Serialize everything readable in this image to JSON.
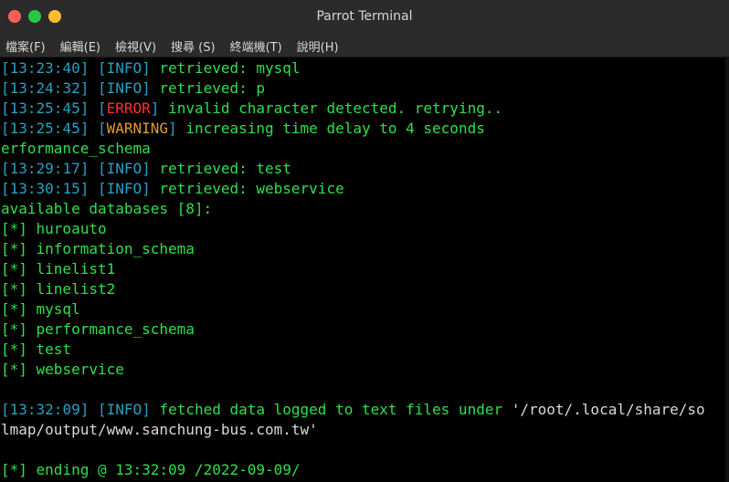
{
  "window": {
    "title": "Parrot Terminal",
    "controls": {
      "close_color": "#ff5f57",
      "minimize_color": "#28c840",
      "maximize_color": "#febc2e"
    }
  },
  "menu": {
    "items": [
      "檔案(F)",
      "編輯(E)",
      "檢視(V)",
      "搜尋 (S)",
      "終端機(T)",
      "說明(H)"
    ]
  },
  "colors": {
    "background": "#000000",
    "green": "#2fe04b",
    "cyan": "#27a0c4",
    "red": "#ff2f2f",
    "orange": "#e09b2a"
  },
  "terminal": {
    "l1": {
      "ts": "13:23:40",
      "level": "INFO",
      "msg": " retrieved: mysql"
    },
    "l2": {
      "ts": "13:24:32",
      "level": "INFO",
      "msg": " retrieved: p"
    },
    "l3": {
      "ts": "13:25:45",
      "level": "ERROR",
      "msg": " invalid character detected. retrying.."
    },
    "l4": {
      "ts": "13:25:45",
      "level": "WARNING",
      "msg": " increasing time delay to 4 seconds"
    },
    "l5": "erformance_schema",
    "l6": {
      "ts": "13:29:17",
      "level": "INFO",
      "msg": " retrieved: test"
    },
    "l7": {
      "ts": "13:30:15",
      "level": "INFO",
      "msg": " retrieved: webservice"
    },
    "available": "available databases [8]:",
    "databases": [
      "huroauto",
      "information_schema",
      "linelist1",
      "linelist2",
      "mysql",
      "performance_schema",
      "test",
      "webservice"
    ],
    "fetched": {
      "ts": "13:32:09",
      "level": "INFO",
      "msg": " fetched data logged to text files under ",
      "path_part1": "'/root/.local/share/so",
      "path_part2": "lmap/output/www.sanchung-bus.com.tw'"
    },
    "ending": "[*] ending @ 13:32:09 /2022-09-09/"
  }
}
